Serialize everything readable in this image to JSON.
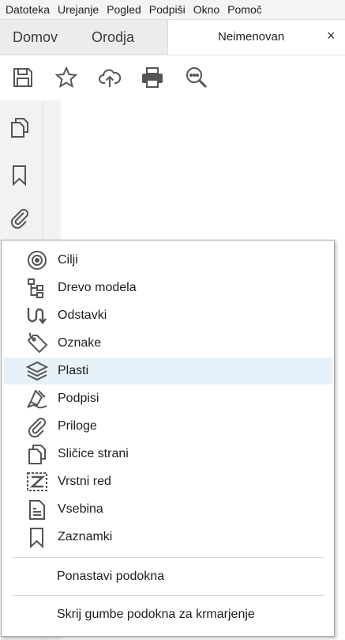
{
  "menubar": {
    "items": [
      "Datoteka",
      "Urejanje",
      "Pogled",
      "Podpiši",
      "Okno",
      "Pomoč"
    ]
  },
  "tabs": {
    "home": "Domov",
    "tools": "Orodja",
    "document": "Neimenovan",
    "close_symbol": "×"
  },
  "toolbar": {
    "icons": [
      "save-icon",
      "star-icon",
      "cloud-upload-icon",
      "print-icon",
      "zoom-search-icon"
    ]
  },
  "leftpanel": {
    "icons": [
      "page-thumbnails-icon",
      "bookmark-icon",
      "attachment-icon"
    ]
  },
  "popup": {
    "items": [
      {
        "label": "Cilji",
        "icon": "target-icon"
      },
      {
        "label": "Drevo modela",
        "icon": "model-tree-icon"
      },
      {
        "label": "Odstavki",
        "icon": "paragraphs-icon"
      },
      {
        "label": "Oznake",
        "icon": "tag-icon"
      },
      {
        "label": "Plasti",
        "icon": "layers-icon"
      },
      {
        "label": "Podpisi",
        "icon": "signature-pen-icon"
      },
      {
        "label": "Priloge",
        "icon": "attachment-icon"
      },
      {
        "label": "Sličice strani",
        "icon": "page-thumbnails-icon"
      },
      {
        "label": "Vrstni red",
        "icon": "order-icon"
      },
      {
        "label": "Vsebina",
        "icon": "content-icon"
      },
      {
        "label": "Zaznamki",
        "icon": "bookmark-icon"
      }
    ],
    "highlighted": "Plasti",
    "reset": "Ponastavi podokna",
    "hide": "Skrij gumbe podokna za krmarjenje"
  },
  "colors": {
    "highlight": "#e7f1fa",
    "icon": "#555555",
    "panel_bg": "#f2f2f2"
  }
}
